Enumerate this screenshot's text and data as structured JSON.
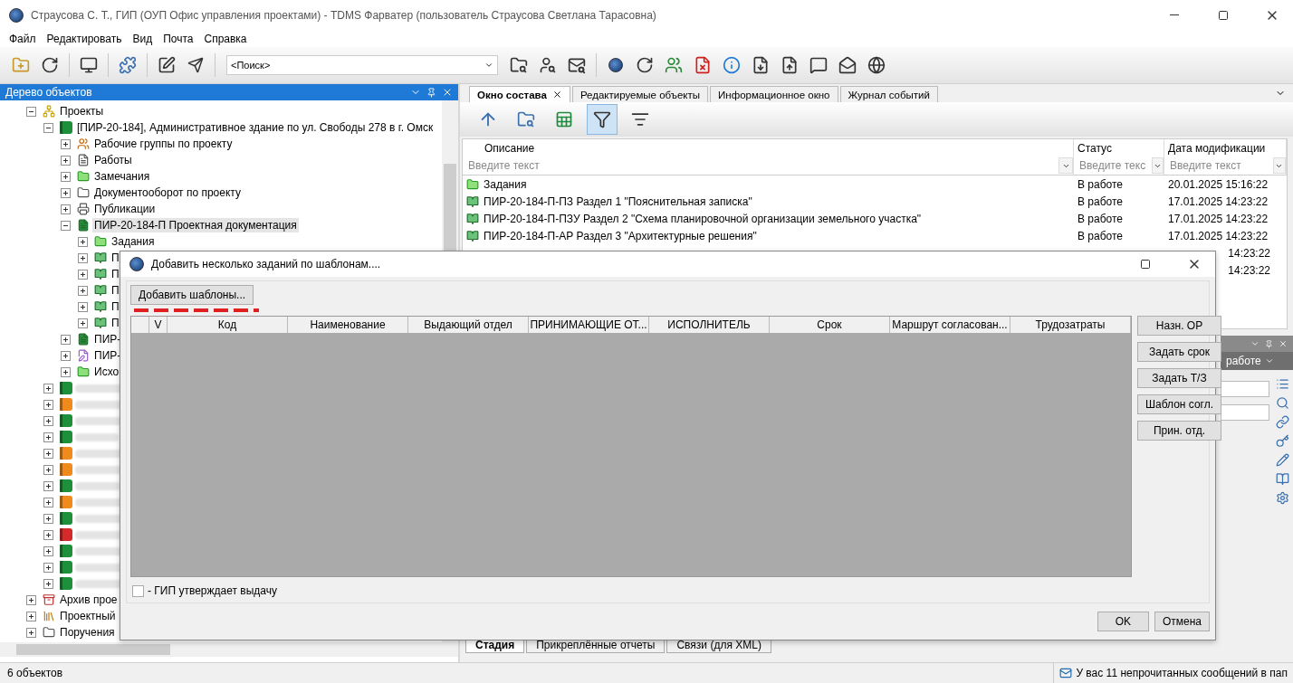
{
  "window": {
    "title": "Страусова С. Т., ГИП (ОУП Офис управления проектами) - TDMS Фарватер (пользователь Страусова Светлана Тарасовна)"
  },
  "menu": [
    "Файл",
    "Редактировать",
    "Вид",
    "Почта",
    "Справка"
  ],
  "search": {
    "value": "<Поиск>"
  },
  "tree_panel": {
    "title": "Дерево объектов",
    "items": [
      {
        "label": "Проекты",
        "kind": "projects",
        "expanded": true,
        "selected": false,
        "children": [
          {
            "label": "[ПИР-20-184], Административное здание по ул. Свободы 278 в г. Омск",
            "kind": "project",
            "color": "#1e8f3a",
            "expanded": true,
            "selected": false,
            "children": [
              {
                "label": "Рабочие группы по проекту",
                "kind": "group",
                "expanded": false,
                "selected": false
              },
              {
                "label": "Работы",
                "kind": "works",
                "expanded": false,
                "selected": false
              },
              {
                "label": "Замечания",
                "kind": "folder-green",
                "expanded": false,
                "selected": false
              },
              {
                "label": "Документооборот по проекту",
                "kind": "folder",
                "expanded": false,
                "selected": false
              },
              {
                "label": "Публикации",
                "kind": "print",
                "expanded": false,
                "selected": false
              },
              {
                "label": "ПИР-20-184-П Проектная документация",
                "kind": "docset",
                "expanded": true,
                "selected": true,
                "children": [
                  {
                    "label": "Задания",
                    "kind": "folder-green",
                    "expanded": false,
                    "selected": false
                  },
                  {
                    "label": "П",
                    "kind": "pages",
                    "expanded": false,
                    "selected": false
                  },
                  {
                    "label": "П",
                    "kind": "pages",
                    "expanded": false,
                    "selected": false
                  },
                  {
                    "label": "П",
                    "kind": "pages",
                    "expanded": false,
                    "selected": false
                  },
                  {
                    "label": "П",
                    "kind": "pages",
                    "expanded": false,
                    "selected": false
                  },
                  {
                    "label": "П",
                    "kind": "pages",
                    "expanded": false,
                    "selected": false
                  }
                ]
              },
              {
                "label": "ПИР-",
                "kind": "docset",
                "expanded": false,
                "selected": false
              },
              {
                "label": "ПИР-",
                "kind": "edit",
                "expanded": false,
                "selected": false
              },
              {
                "label": "Исхо",
                "kind": "folder-green",
                "expanded": false,
                "selected": false
              }
            ]
          },
          {
            "kind": "project",
            "color": "#1e8f3a",
            "expanded": false,
            "selected": false
          },
          {
            "kind": "project",
            "color": "#f08a1c",
            "expanded": false,
            "selected": false
          },
          {
            "kind": "project",
            "color": "#1e8f3a",
            "expanded": false,
            "selected": false
          },
          {
            "kind": "project",
            "color": "#1e8f3a",
            "expanded": false,
            "selected": false
          },
          {
            "kind": "project",
            "color": "#f08a1c",
            "expanded": false,
            "selected": false
          },
          {
            "kind": "project",
            "color": "#f08a1c",
            "expanded": false,
            "selected": false
          },
          {
            "kind": "project",
            "color": "#1e8f3a",
            "expanded": false,
            "selected": false
          },
          {
            "kind": "project",
            "color": "#f08a1c",
            "expanded": false,
            "selected": false
          },
          {
            "kind": "project",
            "color": "#1e8f3a",
            "expanded": false,
            "selected": false
          },
          {
            "kind": "project",
            "color": "#d42a2a",
            "expanded": false,
            "selected": false
          },
          {
            "kind": "project",
            "color": "#1e8f3a",
            "expanded": false,
            "selected": false
          },
          {
            "kind": "project",
            "color": "#1e8f3a",
            "expanded": false,
            "selected": false
          },
          {
            "kind": "project",
            "color": "#1e8f3a",
            "expanded": false,
            "selected": false
          }
        ]
      },
      {
        "label": "Архив прое",
        "kind": "archive",
        "expanded": false,
        "selected": false
      },
      {
        "label": "Проектный",
        "kind": "chart",
        "expanded": false,
        "selected": false
      },
      {
        "label": "Поручения",
        "kind": "folder",
        "expanded": false,
        "selected": false
      }
    ]
  },
  "status_bar": {
    "count": "6 объектов",
    "message": "У вас 11 непрочитанных сообщений в пап"
  },
  "tabs": [
    {
      "label": "Окно состава",
      "selected": true
    },
    {
      "label": "Редактируемые объекты",
      "selected": false
    },
    {
      "label": "Информационное окно",
      "selected": false
    },
    {
      "label": "Журнал событий",
      "selected": false
    }
  ],
  "panel_tools": [
    {
      "kind": "up",
      "selected": false
    },
    {
      "kind": "tree-search",
      "selected": false
    },
    {
      "kind": "excel",
      "selected": false
    },
    {
      "kind": "filter",
      "selected": true
    },
    {
      "kind": "filter-list",
      "selected": false
    }
  ],
  "table": {
    "columns": [
      {
        "label": "Описание",
        "placeholder": "Введите текст"
      },
      {
        "label": "Статус",
        "placeholder": "Введите текс"
      },
      {
        "label": "Дата модификации",
        "placeholder": "Введите текст"
      }
    ],
    "rows": [
      {
        "kind": "folder-green",
        "description": "Задания",
        "status": "В работе",
        "date": "20.01.2025 15:16:22"
      },
      {
        "kind": "pages",
        "description": "ПИР-20-184-П-ПЗ Раздел 1 \"Пояснительная записка\"",
        "status": "В работе",
        "date": "17.01.2025 14:23:22"
      },
      {
        "kind": "pages",
        "description": "ПИР-20-184-П-ПЗУ Раздел 2 \"Схема планировочной организации земельного участка\"",
        "status": "В работе",
        "date": "17.01.2025 14:23:22"
      },
      {
        "kind": "pages",
        "description": "ПИР-20-184-П-АР Раздел 3 \"Архитектурные решения\"",
        "status": "В работе",
        "date": "17.01.2025 14:23:22"
      },
      {
        "date": "14:23:22"
      },
      {
        "date": "14:23:22"
      }
    ]
  },
  "side_panel": {
    "status": "работе"
  },
  "bottom_tabs": [
    {
      "label": "Стадия",
      "selected": true
    },
    {
      "label": "Прикреплённые отчеты",
      "selected": false
    },
    {
      "label": "Связи (для XML)",
      "selected": false
    }
  ],
  "dialog": {
    "title": "Добавить несколько заданий по шаблонам....",
    "add_button": "Добавить шаблоны...",
    "columns": [
      "V",
      "Код",
      "Наименование",
      "Выдающий отдел",
      "ПРИНИМАЮЩИЕ ОТ...",
      "ИСПОЛНИТЕЛЬ",
      "Срок",
      "Маршрут согласован...",
      "Трудозатраты"
    ],
    "actions": [
      "Назн. ОР",
      "Задать срок",
      "Задать Т/З",
      "Шаблон согл.",
      "Прин. отд."
    ],
    "checkbox": {
      "label": "- ГИП утверждает выдачу",
      "checked": false
    },
    "buttons": [
      "OK",
      "Отмена"
    ]
  }
}
